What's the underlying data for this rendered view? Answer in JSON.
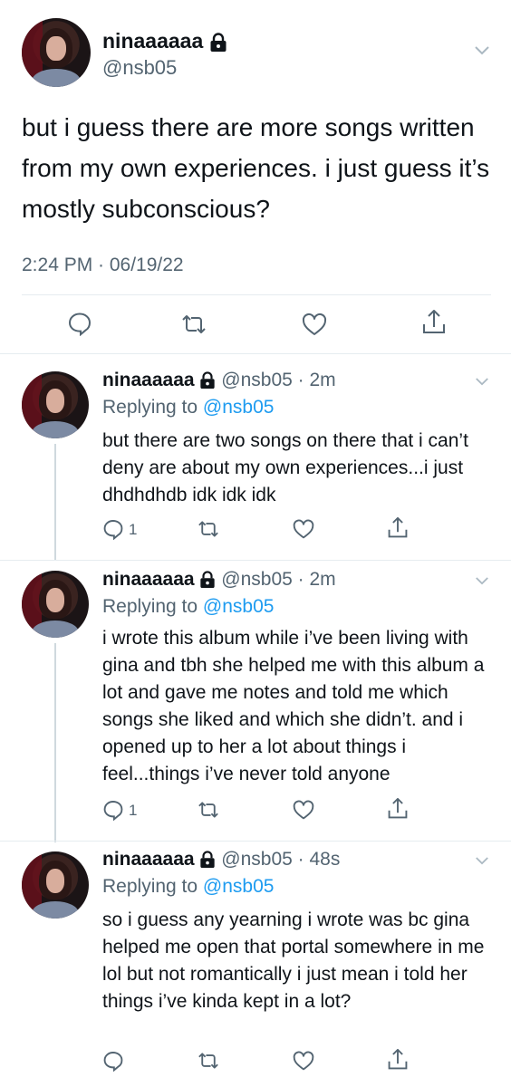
{
  "main_tweet": {
    "display_name": "ninaaaaaa",
    "handle": "@nsb05",
    "text": "but i guess there are more songs written from my own experiences. i just guess it’s mostly subconscious?",
    "timestamp": "2:24 PM · 06/19/22"
  },
  "replies": [
    {
      "display_name": "ninaaaaaa",
      "handle_time": "@nsb05 · 2m",
      "replying_prefix": "Replying to ",
      "replying_handle": "@nsb05",
      "text": "but there are two songs on there that i can’t deny are about my own experiences...i just dhdhdhdb idk idk idk",
      "reply_count": "1"
    },
    {
      "display_name": "ninaaaaaa",
      "handle_time": "@nsb05 · 2m",
      "replying_prefix": "Replying to ",
      "replying_handle": "@nsb05",
      "text": "i wrote this album while i’ve been living with gina and tbh she helped me with this album a lot and gave me notes and told me which songs she liked and which she didn’t. and i opened up to her a lot about things i feel...things i’ve never told anyone",
      "reply_count": "1"
    },
    {
      "display_name": "ninaaaaaa",
      "handle_time": "@nsb05 · 48s",
      "replying_prefix": "Replying to ",
      "replying_handle": "@nsb05",
      "text": "so i guess any yearning i wrote was bc gina helped me open that portal somewhere in me lol but not romantically i just mean i told her things i’ve kinda kept in a lot?",
      "reply_count": ""
    }
  ],
  "icons": [
    "lock-icon",
    "chevron-down-icon",
    "reply-icon",
    "retweet-icon",
    "like-icon",
    "share-icon"
  ],
  "colors": {
    "text": "#0f1419",
    "secondary": "#536471",
    "accent": "#1d9bf0",
    "divider": "#e6ecf0"
  }
}
